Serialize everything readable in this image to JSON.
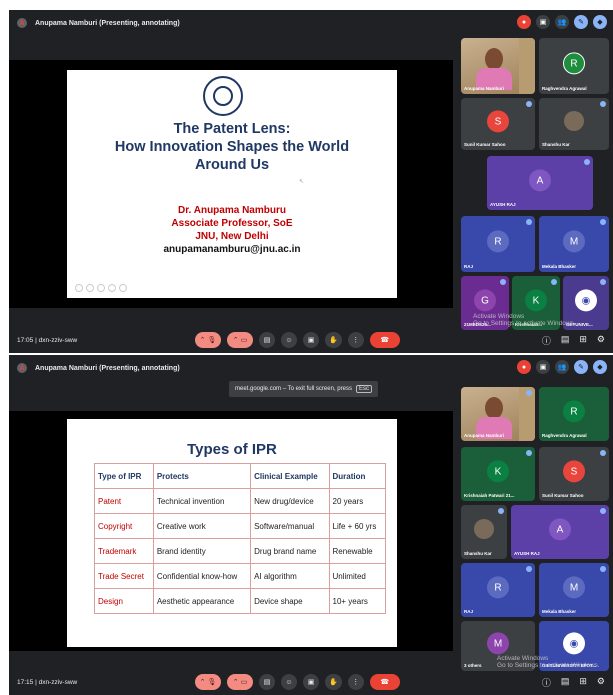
{
  "colors": {
    "meet_bg": "#202124",
    "tile_bg": "#3c4043",
    "end_call": "#ea4335",
    "slide_title": "#1f3864",
    "slide_red": "#c00000"
  },
  "panel1": {
    "presenter": "Anupama Namburi (Presenting, annotating)",
    "clock": "17:05",
    "meeting_code": "dxn-zziv-sww",
    "participants": {
      "presenter_tile": "Anupama Namburi",
      "r_tile": {
        "initial": "R",
        "name": "Raghvendra Agrawal"
      },
      "s_tile": {
        "initial": "S",
        "name": "Sunil Kumar Sahoo"
      },
      "shanshu": {
        "name": "Shanshu Kar"
      },
      "ayush": {
        "initial": "A",
        "name": "AYUSH RAJ"
      },
      "raj": {
        "initial": "R",
        "name": "RAJ"
      },
      "mekala": {
        "initial": "M",
        "name": "Mekala Bhasker"
      },
      "g_tile": {
        "initial": "G",
        "name": "21MEDS26..."
      },
      "k_tile": {
        "initial": "K",
        "name": "Krishnaiah..."
      },
      "getuniv": {
        "name": "GETUNIVE..."
      }
    },
    "watermark": "Activate Windows\nGo to Settings to activate Windows.",
    "slide": {
      "title_line1": "The Patent Lens:",
      "title_line2": "How Innovation Shapes the World",
      "title_line3": "Around Us",
      "author": "Dr. Anupama Namburu",
      "role": "Associate Professor, SoE",
      "institution": "JNU, New Delhi",
      "email": "anupamanamburu@jnu.ac.in"
    }
  },
  "panel2": {
    "presenter": "Anupama Namburi (Presenting, annotating)",
    "notice": "meet.google.com – To exit full screen, press",
    "notice_key": "Esc",
    "clock": "17:15",
    "meeting_code": "dxn-zziv-sww",
    "participants": {
      "presenter_tile": "Anupama Namburi",
      "r_tile": {
        "initial": "R",
        "name": "Raghvendra Agrawal"
      },
      "k_tile": {
        "initial": "K",
        "name": "Krishnaiah Patwari 21..."
      },
      "s_tile": {
        "initial": "S",
        "name": "Sunil Kumar Sahoo"
      },
      "shanshu": {
        "name": "Shanshu Kar"
      },
      "ayush": {
        "initial": "A",
        "name": "AYUSH RAJ"
      },
      "raj": {
        "initial": "R",
        "name": "RAJ"
      },
      "mekala": {
        "initial": "M",
        "name": "Mekala Bhasker"
      },
      "others": {
        "initial": "M",
        "name": "3 others"
      },
      "getuniv": {
        "name": "GIETUNIVERSITY EPOT..."
      }
    },
    "watermark": "Activate Windows\nGo to Settings to activate Windows.",
    "slide": {
      "title": "Types of IPR",
      "headers": [
        "Type of IPR",
        "Protects",
        "Clinical Example",
        "Duration"
      ],
      "rows": [
        [
          "Patent",
          "Technical invention",
          "New drug/device",
          "20 years"
        ],
        [
          "Copyright",
          "Creative work",
          "Software/manual",
          "Life + 60 yrs"
        ],
        [
          "Trademark",
          "Brand identity",
          "Drug brand name",
          "Renewable"
        ],
        [
          "Trade Secret",
          "Confidential know-how",
          "AI algorithm",
          "Unlimited"
        ],
        [
          "Design",
          "Aesthetic appearance",
          "Device shape",
          "10+ years"
        ]
      ]
    }
  }
}
